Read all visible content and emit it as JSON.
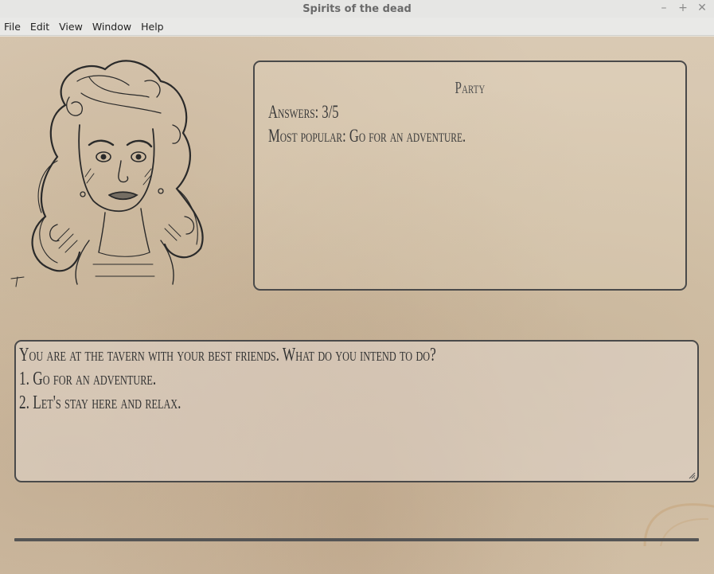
{
  "window": {
    "title": "Spirits of the dead",
    "controls": {
      "minimize": "–",
      "maximize": "+",
      "close": "✕"
    }
  },
  "menu": {
    "items": [
      {
        "label": "File"
      },
      {
        "label": "Edit"
      },
      {
        "label": "View"
      },
      {
        "label": "Window"
      },
      {
        "label": "Help"
      }
    ]
  },
  "party": {
    "title": "Party",
    "answers": "Answers: 3/5",
    "most_popular": "Most popular: Go for an adventure."
  },
  "question": {
    "lines": [
      "You are at the tavern with your best friends. What do you intend to do?",
      "1. Go for an adventure.",
      "2. Let's stay here and relax."
    ]
  },
  "input": {
    "value": ""
  },
  "colors": {
    "parchment": "#d6c6ad",
    "border": "#4a4a4a",
    "text": "#333333"
  }
}
